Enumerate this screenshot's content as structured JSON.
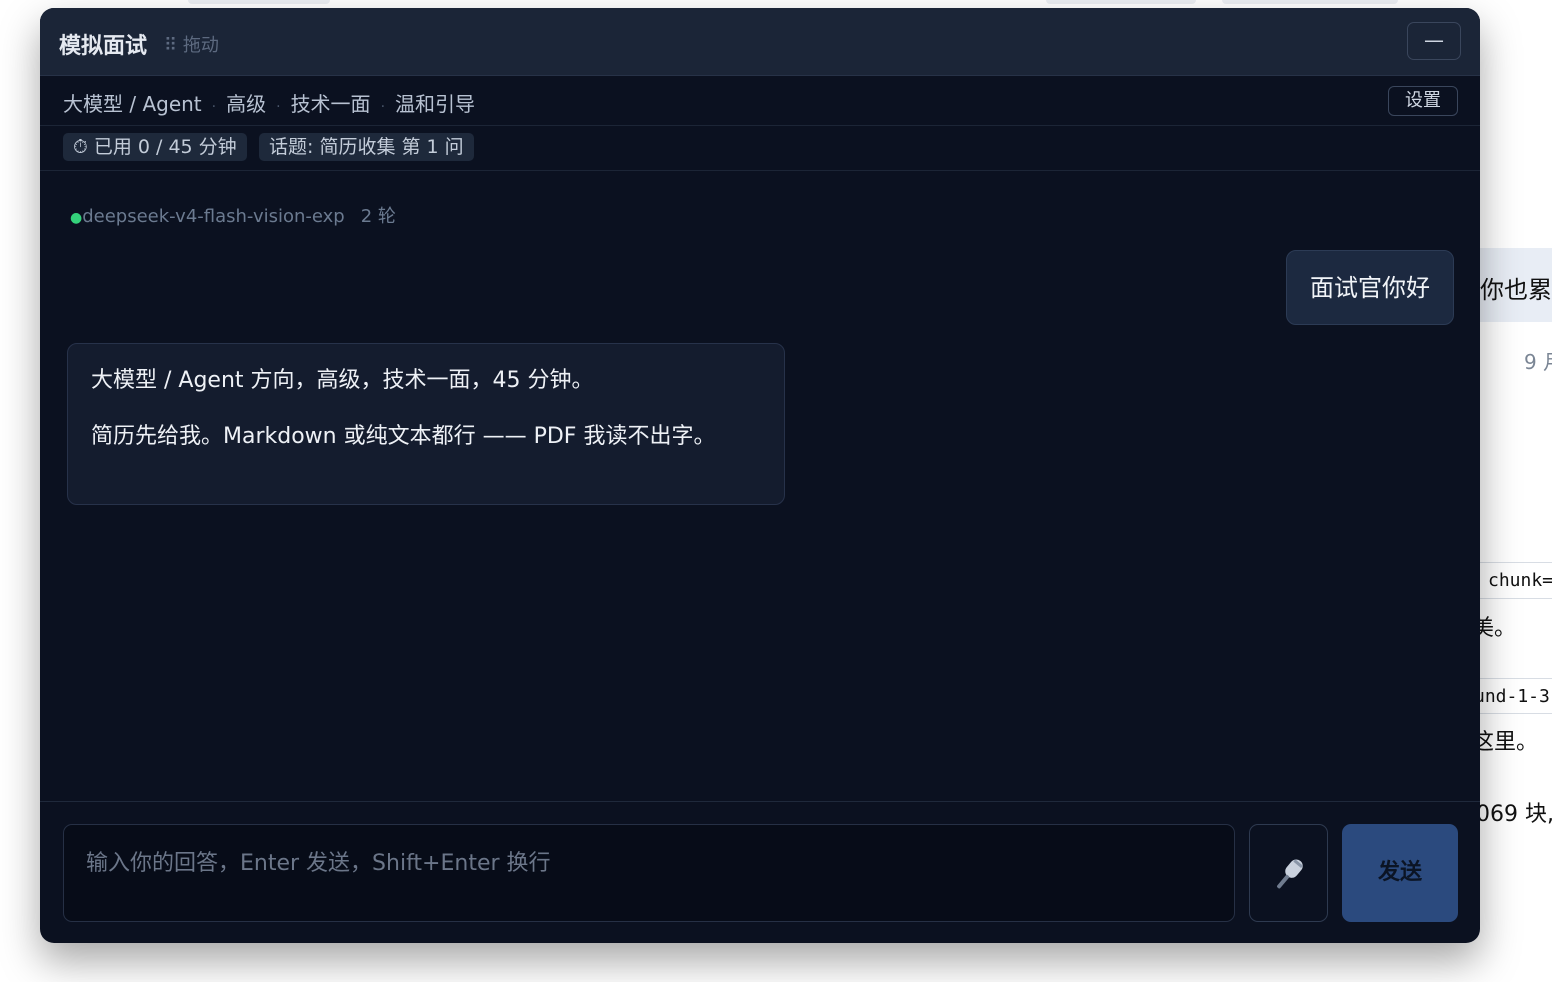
{
  "window": {
    "title": "模拟面试",
    "drag_label": "⠿ 拖动",
    "minimize_label": "—"
  },
  "meta": {
    "direction": "大模型 / Agent",
    "level": "高级",
    "round": "技术一面",
    "style": "温和引导",
    "separator": "·",
    "settings_label": "设置"
  },
  "status": {
    "timer": "⏱ 已用 0 / 45 分钟",
    "topic": "话题: 简历收集 第 1 问"
  },
  "model": {
    "dot": "●",
    "name": "deepseek-v4-flash-vision-exp",
    "rounds": "2 轮"
  },
  "messages": {
    "user": "面试官你好",
    "assistant_line1": "大模型 / Agent 方向，高级，技术一面，45 分钟。",
    "assistant_line2": "简历先给我。Markdown 或纯文本都行 —— PDF 我读不出字。"
  },
  "composer": {
    "placeholder": "输入你的回答，Enter 发送，Shift+Enter 换行",
    "value": "",
    "send_label": "发送",
    "mic_icon": "microphone-icon"
  },
  "background": {
    "bubble_text": "你也累",
    "date_text": "9 月",
    "chunk_text": "chunk=",
    "line1": "美。",
    "code_text": "und-1-3",
    "line2": "这里。",
    "line3": "069 块,"
  },
  "colors": {
    "window_bg": "#0b1120",
    "titlebar_bg": "#1b2537",
    "accent": "#2b4a7e",
    "status_dot": "#34d27b"
  }
}
